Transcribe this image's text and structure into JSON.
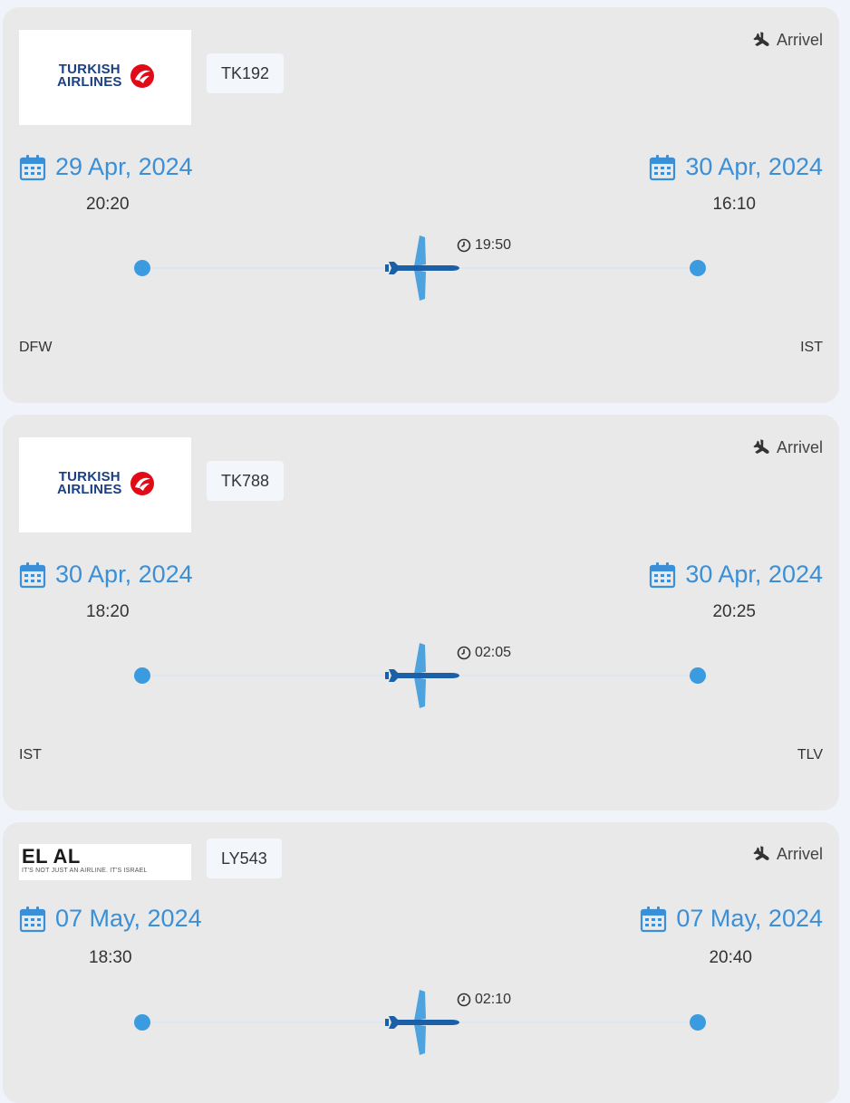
{
  "colors": {
    "accent": "#3b8fd6",
    "dot": "#3a9be0",
    "card": "#e9e9ea",
    "plane_dark": "#1a5fa8",
    "plane_light": "#4ea3df"
  },
  "icons": {
    "calendar": "calendar-icon",
    "plane": "airplane-icon",
    "clock": "clock-icon",
    "arrival": "plane-landing-icon"
  },
  "flights": [
    {
      "airline_logo_text": [
        "TURKISH",
        "AIRLINES"
      ],
      "flight_number": "TK192",
      "status": "Arrivel",
      "departure": {
        "date": "29 Apr, 2024",
        "time": "20:20",
        "airport": "DFW"
      },
      "arrival": {
        "date": "30 Apr, 2024",
        "time": "16:10",
        "airport": "IST"
      },
      "duration": "19:50"
    },
    {
      "airline_logo_text": [
        "TURKISH",
        "AIRLINES"
      ],
      "flight_number": "TK788",
      "status": "Arrivel",
      "departure": {
        "date": "30 Apr, 2024",
        "time": "18:20",
        "airport": "IST"
      },
      "arrival": {
        "date": "30 Apr, 2024",
        "time": "20:25",
        "airport": "TLV"
      },
      "duration": "02:05"
    },
    {
      "airline_logo_text": [
        "EL AL",
        "IT'S NOT JUST AN AIRLINE. IT'S ISRAEL"
      ],
      "flight_number": "LY543",
      "status": "Arrivel",
      "departure": {
        "date": "07 May, 2024",
        "time": "18:30",
        "airport": ""
      },
      "arrival": {
        "date": "07 May, 2024",
        "time": "20:40",
        "airport": ""
      },
      "duration": "02:10"
    }
  ]
}
